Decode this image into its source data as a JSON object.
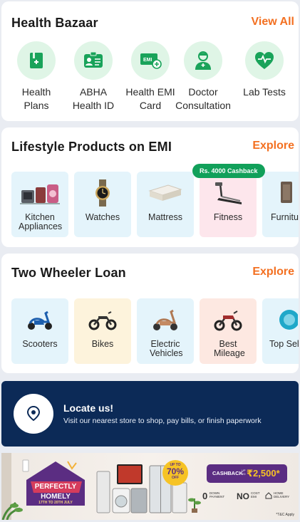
{
  "health_bazaar": {
    "title": "Health Bazaar",
    "link": "View All",
    "items": [
      {
        "label": "Health\nPlans",
        "icon": "health-plans-icon"
      },
      {
        "label": "ABHA\nHealth ID",
        "icon": "abha-id-card-icon"
      },
      {
        "label": "Health EMI\nCard",
        "icon": "emi-card-icon"
      },
      {
        "label": "Doctor\nConsultation",
        "icon": "doctor-icon"
      },
      {
        "label": "Lab Tests",
        "icon": "heart-pulse-icon"
      }
    ]
  },
  "lifestyle": {
    "title": "Lifestyle Products on EMI",
    "link": "Explore",
    "badge": "Rs. 4000 Cashback",
    "items": [
      {
        "label": "Kitchen Appliances",
        "bg": "#e4f4fb"
      },
      {
        "label": "Watches",
        "bg": "#e4f4fb"
      },
      {
        "label": "Mattress",
        "bg": "#e4f4fb"
      },
      {
        "label": "Fitness",
        "bg": "#fde6ec"
      },
      {
        "label": "Furniture",
        "bg": "#e4f4fb"
      }
    ]
  },
  "two_wheeler": {
    "title": "Two Wheeler Loan",
    "link": "Explore",
    "items": [
      {
        "label": "Scooters",
        "bg": "#e4f4fb"
      },
      {
        "label": "Bikes",
        "bg": "#fdf3dc"
      },
      {
        "label": "Electric Vehicles",
        "bg": "#e4f4fb"
      },
      {
        "label": "Best Mileage",
        "bg": "#fde8e1"
      },
      {
        "label": "Top Selling",
        "bg": "#e4f4fb"
      }
    ]
  },
  "locate": {
    "title": "Locate us!",
    "subtitle": "Visit our nearest store to shop, pay bills, or finish paperwork"
  },
  "banner": {
    "headline1": "PERFECTLY",
    "headline2": "HOMELY",
    "dates": "17TH TO 20TH JULY",
    "upto": "UP TO",
    "percent": "70%",
    "off": "OFF",
    "cashback_label": "CASHBACK",
    "cashback_upto": "UP TO",
    "cashback_value": "₹2,500*",
    "zero_down_1": "0",
    "zero_down_2": "DOWN",
    "zero_down_3": "PAYMENT",
    "no_cost_1": "NO",
    "no_cost_2": "COST",
    "no_cost_3": "EMI",
    "home_delivery_1": "HOME",
    "home_delivery_2": "DELIVERY",
    "tnc": "*T&C Apply"
  },
  "colors": {
    "accent": "#f37021",
    "green_badge": "#11a05a",
    "navy": "#0c2a57",
    "health_icon": "#19a35a"
  }
}
